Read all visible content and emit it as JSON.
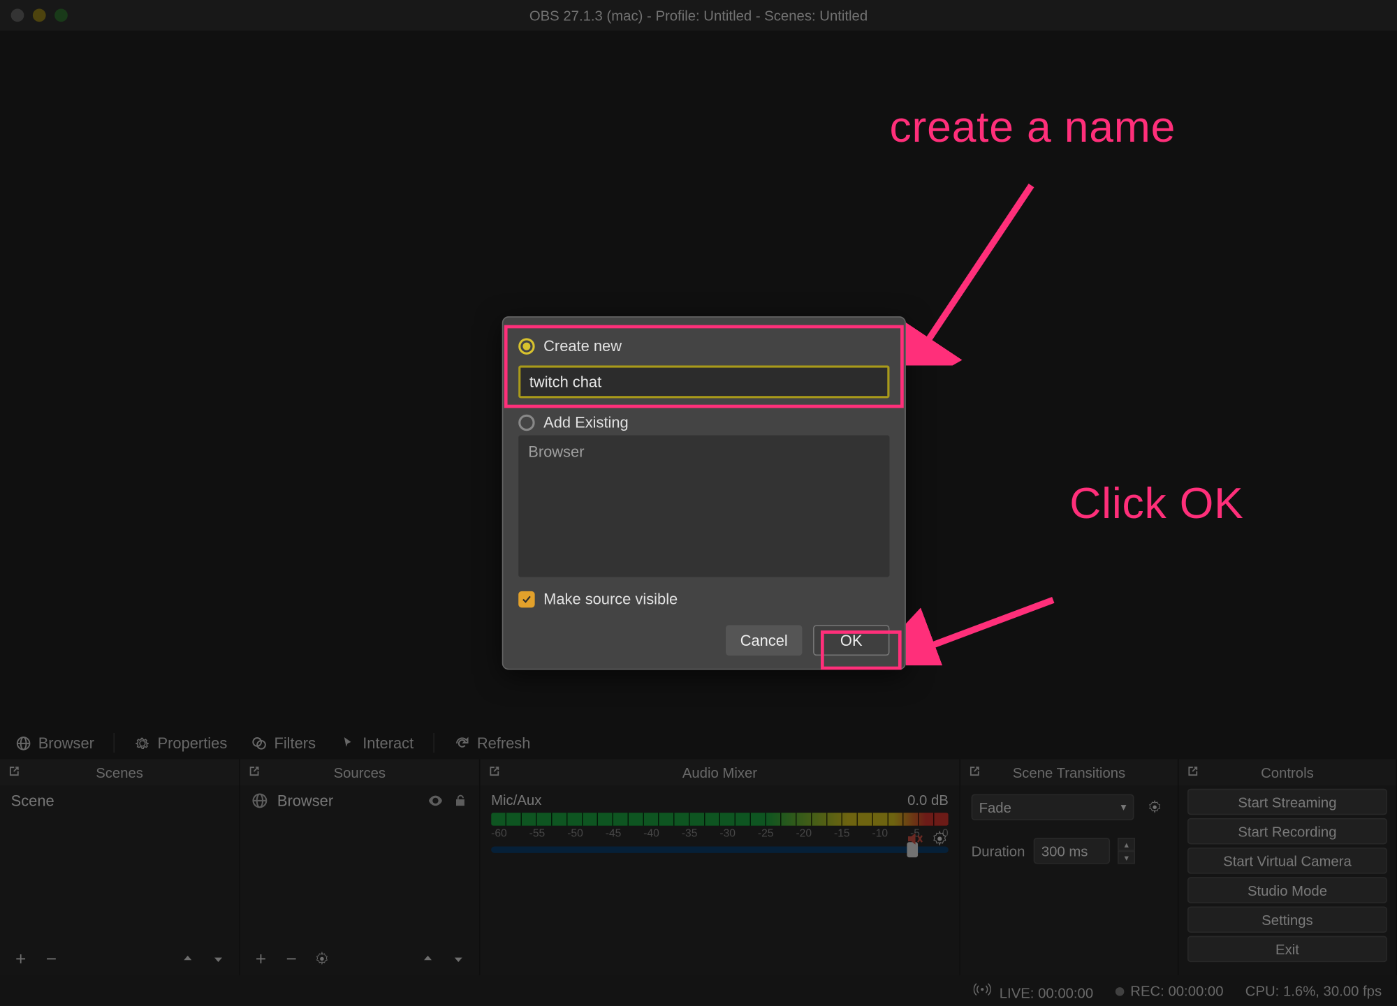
{
  "window": {
    "title": "OBS 27.1.3 (mac) - Profile: Untitled - Scenes: Untitled"
  },
  "toolbar": {
    "source_selected": "Browser",
    "properties": "Properties",
    "filters": "Filters",
    "interact": "Interact",
    "refresh": "Refresh"
  },
  "docks": {
    "scenes": {
      "title": "Scenes",
      "items": [
        "Scene"
      ]
    },
    "sources": {
      "title": "Sources",
      "items": [
        "Browser"
      ]
    },
    "mixer": {
      "title": "Audio Mixer",
      "channel": {
        "name": "Mic/Aux",
        "level": "0.0 dB"
      },
      "scale": [
        "-60",
        "-55",
        "-50",
        "-45",
        "-40",
        "-35",
        "-30",
        "-25",
        "-20",
        "-15",
        "-10",
        "-5",
        "0"
      ]
    },
    "transitions": {
      "title": "Scene Transitions",
      "selected": "Fade",
      "duration_label": "Duration",
      "duration": "300 ms"
    },
    "controls": {
      "title": "Controls",
      "buttons": [
        "Start Streaming",
        "Start Recording",
        "Start Virtual Camera",
        "Studio Mode",
        "Settings",
        "Exit"
      ]
    }
  },
  "status": {
    "live": "LIVE: 00:00:00",
    "rec": "REC: 00:00:00",
    "cpu": "CPU: 1.6%, 30.00 fps"
  },
  "modal": {
    "create_new": "Create new",
    "name_value": "twitch chat",
    "add_existing": "Add Existing",
    "existing_items": [
      "Browser"
    ],
    "make_visible": "Make source visible",
    "cancel": "Cancel",
    "ok": "OK"
  },
  "annotations": {
    "create_name": "create a name",
    "click_ok": "Click OK"
  }
}
